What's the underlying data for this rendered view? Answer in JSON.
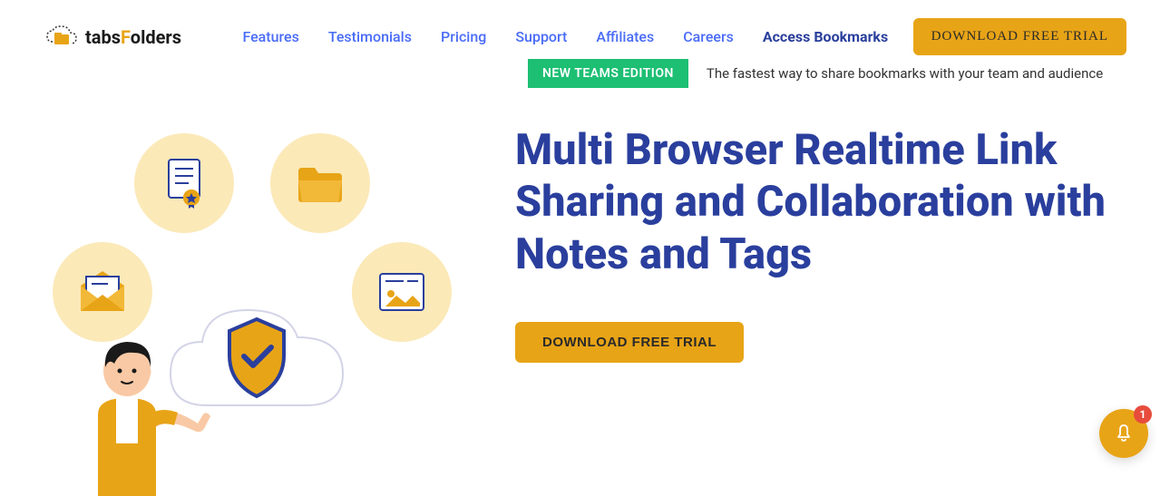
{
  "brand": {
    "name_a": "tabs",
    "name_b": "F",
    "name_c": "olders"
  },
  "nav": {
    "features": "Features",
    "testimonials": "Testimonials",
    "pricing": "Pricing",
    "support": "Support",
    "affiliates": "Affiliates",
    "careers": "Careers",
    "access": "Access Bookmarks"
  },
  "cta_header": "DOWNLOAD FREE TRIAL",
  "badge": "NEW TEAMS EDITION",
  "tagline": "The fastest way to share bookmarks with your team and audience",
  "headline": "Multi Browser Realtime Link Sharing and Collaboration with Notes and Tags",
  "cta_hero": "DOWNLOAD FREE TRIAL",
  "notif_count": "1"
}
